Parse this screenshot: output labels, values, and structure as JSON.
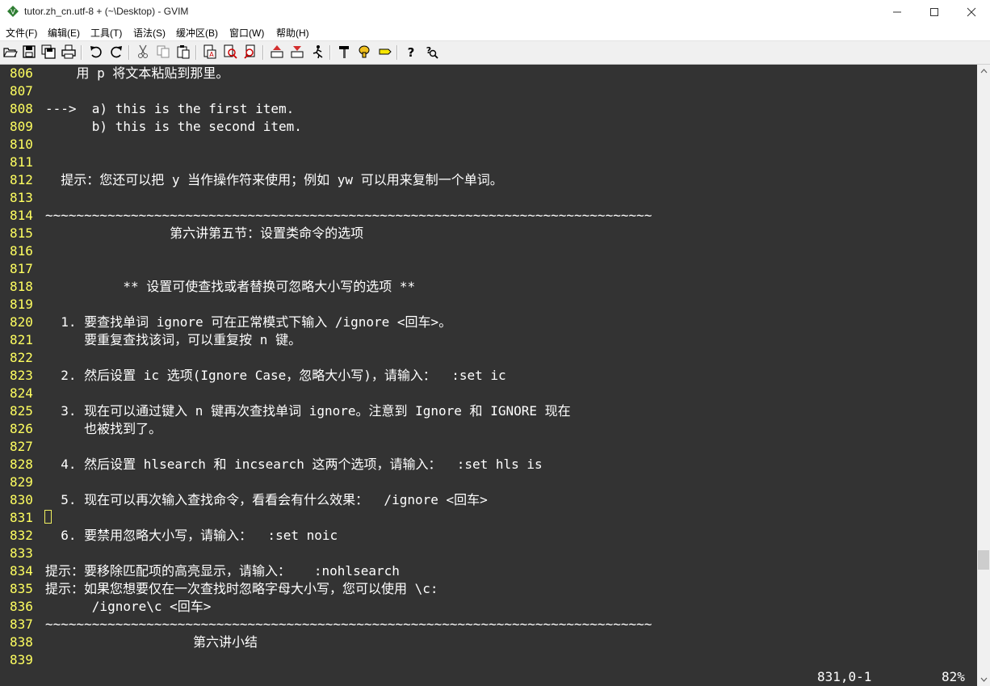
{
  "window": {
    "title": "tutor.zh_cn.utf-8 + (~\\Desktop) - GVIM",
    "icon": "gvim-icon",
    "controls": [
      "minimize-icon",
      "maximize-icon",
      "close-icon"
    ]
  },
  "menu": [
    {
      "label": "文件(F)"
    },
    {
      "label": "编辑(E)"
    },
    {
      "label": "工具(T)"
    },
    {
      "label": "语法(S)"
    },
    {
      "label": "缓冲区(B)"
    },
    {
      "label": "窗口(W)"
    },
    {
      "label": "帮助(H)"
    }
  ],
  "toolbar": [
    {
      "name": "open-icon"
    },
    {
      "name": "save-icon"
    },
    {
      "name": "save-all-icon"
    },
    {
      "name": "print-icon"
    },
    {
      "name": "undo-icon"
    },
    {
      "name": "redo-icon"
    },
    {
      "name": "cut-icon"
    },
    {
      "name": "copy-icon"
    },
    {
      "name": "paste-icon"
    },
    {
      "name": "replace-icon"
    },
    {
      "name": "find-next-icon"
    },
    {
      "name": "find-prev-icon"
    },
    {
      "name": "load-session-icon"
    },
    {
      "name": "save-session-icon"
    },
    {
      "name": "run-script-icon"
    },
    {
      "name": "make-icon"
    },
    {
      "name": "shell-icon"
    },
    {
      "name": "ctags-icon"
    },
    {
      "name": "help-icon"
    },
    {
      "name": "find-help-icon"
    }
  ],
  "buffer": {
    "lines": [
      {
        "num": "806",
        "text": "    用 p 将文本粘贴到那里。"
      },
      {
        "num": "807",
        "text": ""
      },
      {
        "num": "808",
        "text": "--->  a) this is the first item."
      },
      {
        "num": "809",
        "text": "      b) this is the second item."
      },
      {
        "num": "810",
        "text": ""
      },
      {
        "num": "811",
        "text": ""
      },
      {
        "num": "812",
        "text": "  提示：您还可以把 y 当作操作符来使用；例如 yw 可以用来复制一个单词。"
      },
      {
        "num": "813",
        "text": ""
      },
      {
        "num": "814",
        "text": "~~~~~~~~~~~~~~~~~~~~~~~~~~~~~~~~~~~~~~~~~~~~~~~~~~~~~~~~~~~~~~~~~~~~~~~~~~~~~~"
      },
      {
        "num": "815",
        "text": "                第六讲第五节：设置类命令的选项"
      },
      {
        "num": "816",
        "text": ""
      },
      {
        "num": "817",
        "text": ""
      },
      {
        "num": "818",
        "text": "          ** 设置可使查找或者替换可忽略大小写的选项 **"
      },
      {
        "num": "819",
        "text": ""
      },
      {
        "num": "820",
        "text": "  1. 要查找单词 ignore 可在正常模式下输入 /ignore <回车>。"
      },
      {
        "num": "821",
        "text": "     要重复查找该词，可以重复按 n 键。"
      },
      {
        "num": "822",
        "text": ""
      },
      {
        "num": "823",
        "text": "  2. 然后设置 ic 选项(Ignore Case，忽略大小写)，请输入：  :set ic"
      },
      {
        "num": "824",
        "text": ""
      },
      {
        "num": "825",
        "text": "  3. 现在可以通过键入 n 键再次查找单词 ignore。注意到 Ignore 和 IGNORE 现在"
      },
      {
        "num": "826",
        "text": "     也被找到了。"
      },
      {
        "num": "827",
        "text": ""
      },
      {
        "num": "828",
        "text": "  4. 然后设置 hlsearch 和 incsearch 这两个选项，请输入：  :set hls is"
      },
      {
        "num": "829",
        "text": ""
      },
      {
        "num": "830",
        "text": "  5. 现在可以再次输入查找命令，看看会有什么效果：  /ignore <回车>"
      },
      {
        "num": "831",
        "text": ""
      },
      {
        "num": "832",
        "text": "  6. 要禁用忽略大小写，请输入：  :set noic"
      },
      {
        "num": "833",
        "text": ""
      },
      {
        "num": "834",
        "text": "提示：要移除匹配项的高亮显示，请输入：   :nohlsearch"
      },
      {
        "num": "835",
        "text": "提示：如果您想要仅在一次查找时忽略字母大小写，您可以使用 \\c:"
      },
      {
        "num": "836",
        "text": "      /ignore\\c <回车>"
      },
      {
        "num": "837",
        "text": "~~~~~~~~~~~~~~~~~~~~~~~~~~~~~~~~~~~~~~~~~~~~~~~~~~~~~~~~~~~~~~~~~~~~~~~~~~~~~~"
      },
      {
        "num": "838",
        "text": "                   第六讲小结"
      },
      {
        "num": "839",
        "text": ""
      }
    ]
  },
  "status": {
    "ruler": "831,0-1",
    "percent": "82%"
  },
  "scrollbar": {
    "position_fraction": 0.82
  },
  "colors": {
    "background": "#333333",
    "line_number": "#ffff60",
    "text": "#ffffff",
    "cursor": "#f0f060"
  }
}
